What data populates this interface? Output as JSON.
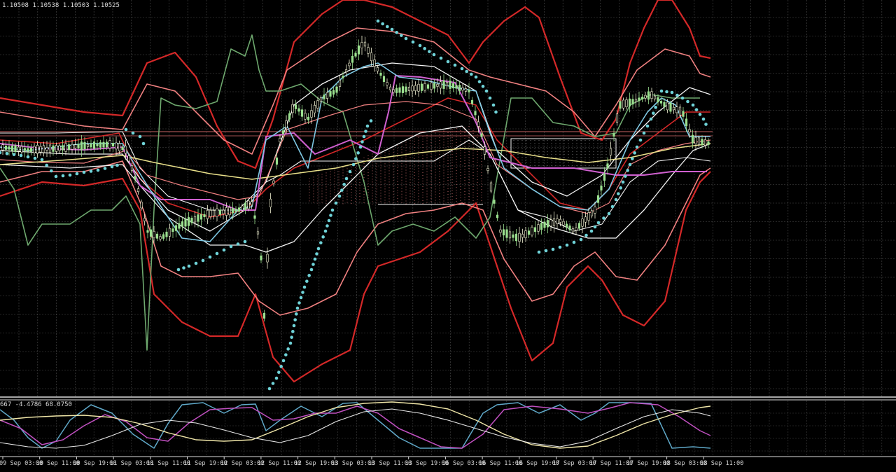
{
  "chart_data": {
    "type": "line",
    "ohlc_readout": "1.10508 1.10538 1.10503 1.10525",
    "sub_readout": "667 -4.4786 68.0750",
    "grid": true,
    "x_labels": [
      "09 Sep 03:00",
      "10 Sep 11:00",
      "10 Sep 19:00",
      "11 Sep 03:00",
      "11 Sep 11:00",
      "11 Sep 19:00",
      "12 Sep 03:00",
      "12 Sep 11:00",
      "12 Sep 19:00",
      "13 Sep 03:00",
      "13 Sep 11:00",
      "13 Sep 19:00",
      "16 Sep 03:00",
      "16 Sep 11:00",
      "16 Sep 19:00",
      "17 Sep 03:00",
      "17 Sep 11:00",
      "17 Sep 19:00",
      "18 Sep 03:00",
      "18 Sep 11:00"
    ],
    "colors": {
      "background": "#000000",
      "grid": "#8a8a8a",
      "separator": "#dcdcdc",
      "bollinger_outer": "#d42828",
      "bollinger_mid": "#f08080",
      "envelope": "#f4f4f4",
      "moving_average": "#e9e08a",
      "fast_line": "#7ec8e3",
      "ichimoku": "#d060d0",
      "chikou": "#6ea86e",
      "sar_dots": "#6fd3d8",
      "candles": "#9be08f",
      "hline": "#c86464",
      "stoch_main": "#5fa8c8",
      "stoch_signal": "#c050c0",
      "rsi": "#f0e6a8"
    },
    "indicators": [
      "bollinger_outer_upper",
      "bollinger_outer_lower",
      "bollinger_inner_upper",
      "bollinger_inner_lower",
      "envelope_upper",
      "envelope_lower",
      "moving_average",
      "fast_line",
      "kijun",
      "chikou",
      "parabolic_sar",
      "candles",
      "stochastic_main",
      "stochastic_signal",
      "oscillator_line"
    ]
  }
}
